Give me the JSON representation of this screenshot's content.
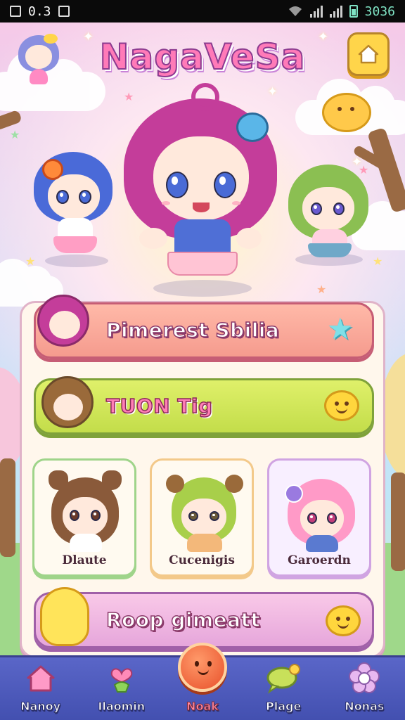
{
  "status_bar": {
    "left_icons": [
      "image-icon",
      "notification-icon",
      "clipboard-icon"
    ],
    "left_text": "0.3",
    "time": "3036"
  },
  "app": {
    "title": "NagaVeSa",
    "home_icon": "house-icon"
  },
  "menu": {
    "profile_label": "Pimerest Sbilia",
    "play_label": "TUON Tig",
    "shop_label": "Roop gimeatt"
  },
  "characters": [
    {
      "name": "Dlaute",
      "hair": "#8a5a3a"
    },
    {
      "name": "Cucenigis",
      "hair": "#a8cf4a"
    },
    {
      "name": "Garoerdn",
      "hair": "#ff9ac7"
    }
  ],
  "nav": [
    {
      "label": "Nanoy",
      "icon": "house-icon"
    },
    {
      "label": "Ilaomin",
      "icon": "heart-figure-icon"
    },
    {
      "label": "Noak",
      "icon": "orange-ball-icon",
      "active": true
    },
    {
      "label": "Plage",
      "icon": "chat-bubble-icon"
    },
    {
      "label": "Nonas",
      "icon": "flower-icon"
    }
  ],
  "colors": {
    "title": "#ff7ab8",
    "nav_bg": "#4350b0",
    "profile_btn": "#f59b8e",
    "play_btn": "#c3dd4a",
    "shop_btn": "#e6a6db"
  }
}
